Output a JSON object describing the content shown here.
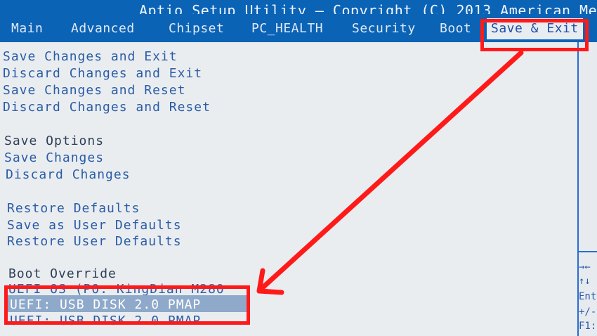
{
  "title": "Aptio Setup Utility – Copyright (C) 2013 American Me",
  "tabs": [
    {
      "label": "Main"
    },
    {
      "label": "Advanced"
    },
    {
      "label": "Chipset"
    },
    {
      "label": "PC_HEALTH"
    },
    {
      "label": "Security"
    },
    {
      "label": "Boot"
    },
    {
      "label": "Save & Exit"
    }
  ],
  "items": {
    "save_changes_exit": "Save Changes and Exit",
    "discard_changes_exit": "Discard Changes and Exit",
    "save_changes_reset": "Save Changes and Reset",
    "discard_changes_reset": "Discard Changes and Reset",
    "save_options": "Save Options",
    "save_changes": "Save Changes",
    "discard_changes": "Discard Changes",
    "restore_defaults": "Restore Defaults",
    "save_user_defaults": "Save as User Defaults",
    "restore_user_defaults": "Restore User Defaults",
    "boot_override": "Boot Override",
    "uefi_kingdian": "UEFI OS (P0: KingDian M280",
    "uefi_usb_1": "UEFI:  USB DISK 2.0 PMAP",
    "uefi_usb_2": "UEFI:  USB DISK 2.0 PMAP"
  },
  "hints": {
    "arrows": "→←",
    "updown": "↑↓",
    "enter": "Ent",
    "plusminus": "+/-",
    "f1": "F1:"
  },
  "colors": {
    "header_blue": "#0b63b6",
    "item_text": "#2a5ca6",
    "annotation_red": "#ff1a1a"
  }
}
